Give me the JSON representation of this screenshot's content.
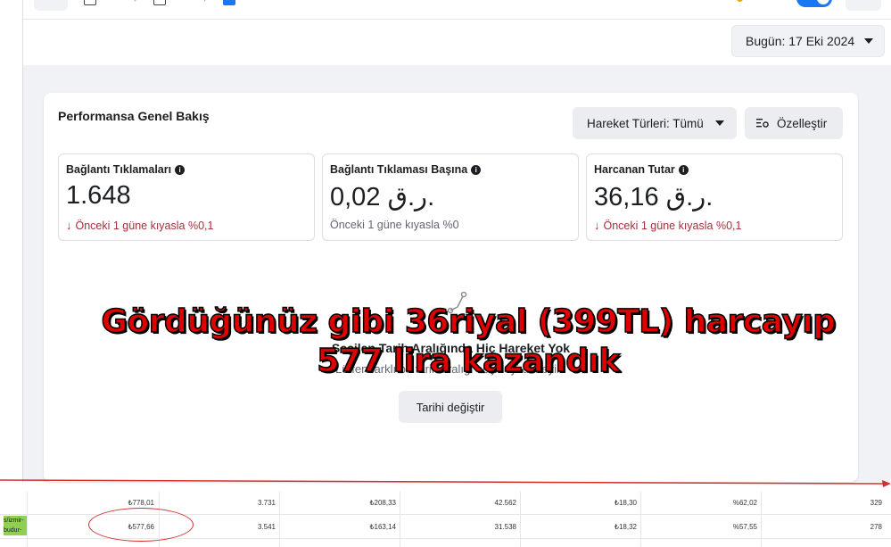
{
  "header": {
    "date_button": "Bugün: 17 Eki 2024"
  },
  "card": {
    "title": "Performansa Genel Bakış",
    "actions_button": "Hareket Türleri: Tümü",
    "customize_button": "Özelleştir"
  },
  "metrics": [
    {
      "label": "Bağlantı Tıklamaları",
      "value": "1.648",
      "compare": "Önceki 1 güne kıyasla %0,1",
      "trend": "down"
    },
    {
      "label": "Bağlantı Tıklaması Başına",
      "value": "0,02 ر.ق.",
      "compare": "Önceki 1 güne kıyasla %0",
      "trend": "flat"
    },
    {
      "label": "Harcanan Tutar",
      "value": "36,16 ر.ق.",
      "compare": "Önceki 1 güne kıyasla %0,1",
      "trend": "down"
    }
  ],
  "empty_state": {
    "title": "Seçilen Tarih Aralığında Hiç Hareket Yok",
    "description": "Lütfen farklı bir tarih aralığı seçmeyi deneyin.",
    "button": "Tarihi değiştir"
  },
  "overlay": {
    "line1": "Gördüğünüz gibi  36riyal (399TL) harcayıp",
    "line2": "577 lira kazandık"
  },
  "table": {
    "row1": [
      "₺778,01",
      "3.731",
      "₺208,33",
      "42.562",
      "₺18,30",
      "%62,02",
      "329"
    ],
    "row2_tag": [
      "s/izmir-",
      "budur-"
    ],
    "row2": [
      "₺577,66",
      "3.541",
      "₺163,14",
      "31.538",
      "₺18,32",
      "%57,55",
      "278"
    ]
  },
  "colors": {
    "accent": "#1877f2",
    "negative": "#a3303b",
    "overlay_text": "#e00000",
    "annotation": "#d32f2f"
  }
}
